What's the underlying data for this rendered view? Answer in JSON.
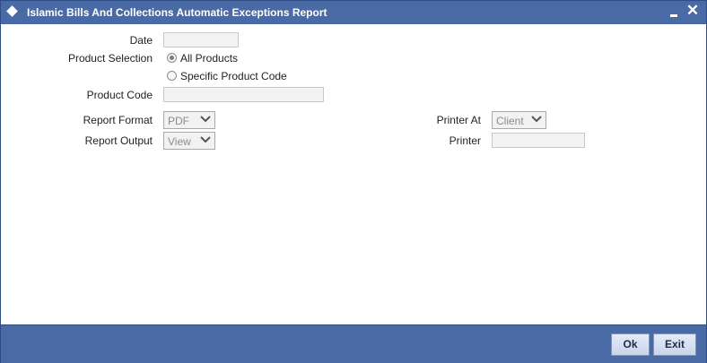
{
  "window": {
    "title": "Islamic Bills And Collections Automatic Exceptions Report",
    "minimize_icon": "minimize-icon",
    "close_symbol": "✕"
  },
  "form": {
    "date": {
      "label": "Date",
      "value": ""
    },
    "product_selection": {
      "label": "Product Selection",
      "options": [
        {
          "label": "All Products",
          "selected": true
        },
        {
          "label": "Specific Product Code",
          "selected": false
        }
      ]
    },
    "product_code": {
      "label": "Product Code",
      "value": ""
    },
    "report_format": {
      "label": "Report Format",
      "value": "PDF"
    },
    "report_output": {
      "label": "Report Output",
      "value": "View"
    },
    "printer_at": {
      "label": "Printer At",
      "value": "Client"
    },
    "printer": {
      "label": "Printer",
      "value": ""
    }
  },
  "footer": {
    "ok_label": "Ok",
    "exit_label": "Exit"
  },
  "colors": {
    "titlebar": "#4a6aa5",
    "footer": "#4a6aa5"
  }
}
